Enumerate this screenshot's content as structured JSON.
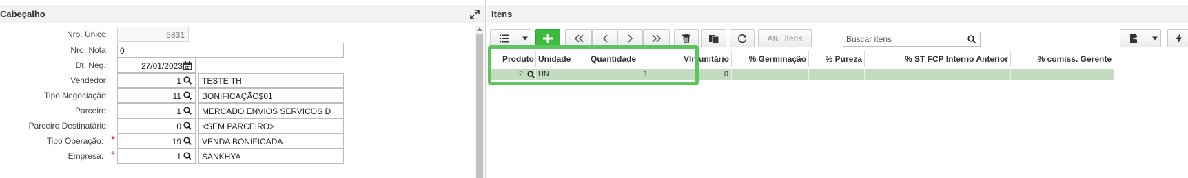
{
  "left_panel": {
    "title": "Cabeçalho",
    "fields": [
      {
        "label": "Nro. Único:",
        "value": "5831",
        "required": false
      },
      {
        "label": "Nro. Nota:",
        "value": "0",
        "required": false
      },
      {
        "label": "Dt. Neg.:",
        "value": "27/01/2023",
        "required": false
      },
      {
        "label": "Vendedor:",
        "code": "1",
        "description": "TESTE TH",
        "required": false
      },
      {
        "label": "Tipo Negociação:",
        "code": "11",
        "description": "BONIFICAÇÃO$01",
        "required": false
      },
      {
        "label": "Parceiro:",
        "code": "1",
        "description": "MERCADO ENVIOS SERVICOS D",
        "required": false
      },
      {
        "label": "Parceiro Destinatário:",
        "code": "0",
        "description": "<SEM PARCEIRO>",
        "required": false
      },
      {
        "label": "Tipo Operação:",
        "code": "19",
        "description": "VENDA BONIFICADA",
        "required": true
      },
      {
        "label": "Empresa:",
        "code": "1",
        "description": "SANKHYA",
        "required": true
      }
    ]
  },
  "right_panel": {
    "title": "Itens",
    "toolbar": {
      "refresh_items_label": "Atu. Itens",
      "search_placeholder": "Buscar itens"
    },
    "grid": {
      "columns": [
        "Produto",
        "Unidade",
        "Quantidade",
        "Vlr. unitário",
        "% Germinação",
        "% Pureza",
        "% ST FCP Interno Anterior",
        "% comiss. Gerente"
      ],
      "rows": [
        {
          "produto": "2",
          "unidade": "UN",
          "quantidade": "1",
          "vlr_unitario": "0",
          "germinacao": "",
          "pureza": "",
          "st_fcp": "",
          "comiss": ""
        }
      ]
    }
  },
  "colors": {
    "accent_green": "#3dbb3d",
    "highlight_green": "#5ec45e",
    "selected_row": "#c3dcc0",
    "required_star": "#e53935"
  }
}
